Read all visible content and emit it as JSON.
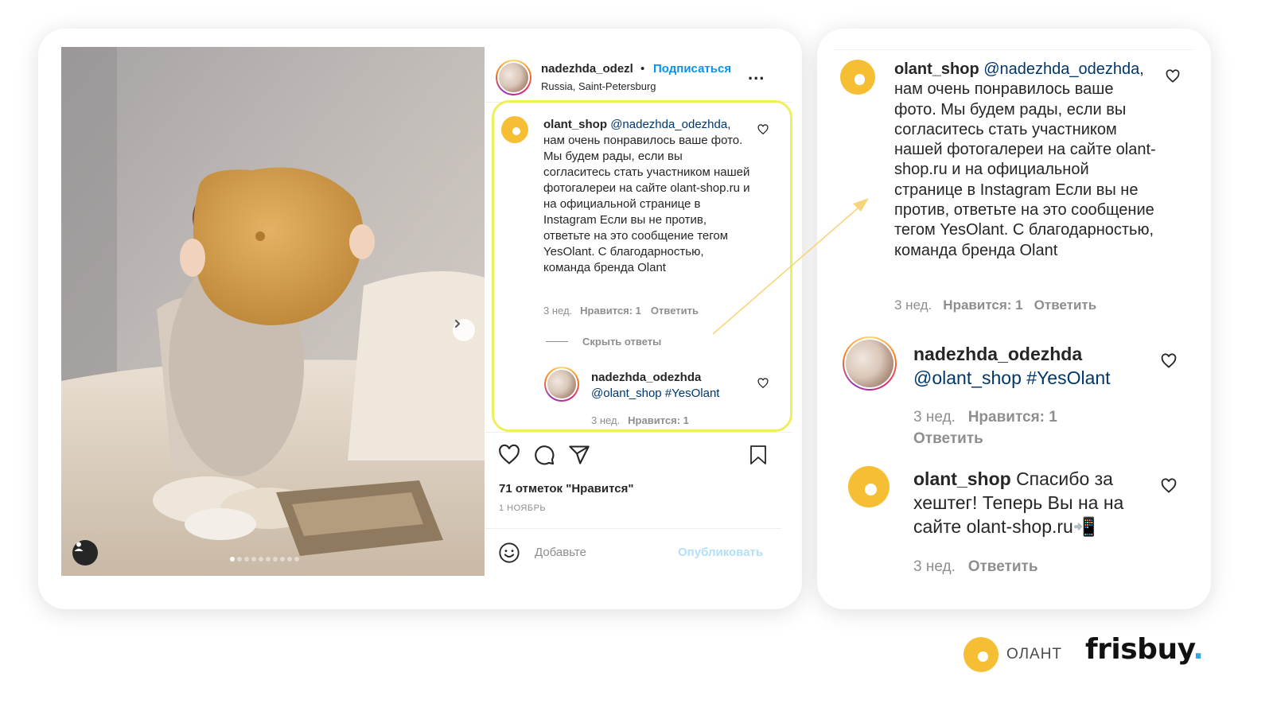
{
  "post": {
    "username": "nadezhda_odezl",
    "dot": "•",
    "follow": "Подписаться",
    "location": "Russia, Saint-Petersburg",
    "more": "...",
    "likes": "71 отметок \"Нравится\"",
    "date": "1 НОЯБРЬ",
    "add_placeholder": "Добавьте",
    "publish": "Опубликовать",
    "carousel_dots": 10
  },
  "comments": [
    {
      "username": "olant_shop",
      "mention": "@nadezhda_odezhda",
      "text": ", нам очень понравилось ваше фото. Мы будем рады, если вы согласитесь стать участником нашей фотогалереи на сайте olant-shop.ru и на официальной странице в Instagram Если вы не против, ответьте на это сообщение тегом YesOlant. С благодарностью, команда бренда Olant",
      "time": "3 нед.",
      "likes": "Нравится: 1",
      "reply": "Ответить"
    }
  ],
  "hide_replies": "Скрыть ответы",
  "reply": {
    "username": "nadezhda_odezhda",
    "text": "@olant_shop #YesOlant",
    "time": "3 нед.",
    "likes": "Нравится: 1",
    "reply": "Ответить"
  },
  "reply2": {
    "username": "olant_shop",
    "text": "Спасибо за хештег! Теперь Вы на на сайте olant-shop.ru📲",
    "time": "3 нед.",
    "reply": "Ответить"
  },
  "brand": {
    "olant": "ОЛАНТ",
    "frisbuy": "frisbuy",
    "frisbuy_dot": "."
  },
  "colors": {
    "link_blue": "#0095f6",
    "mention_blue": "#00376b",
    "highlight_yellow": "#eef05a",
    "olant_yellow": "#f6be33"
  }
}
